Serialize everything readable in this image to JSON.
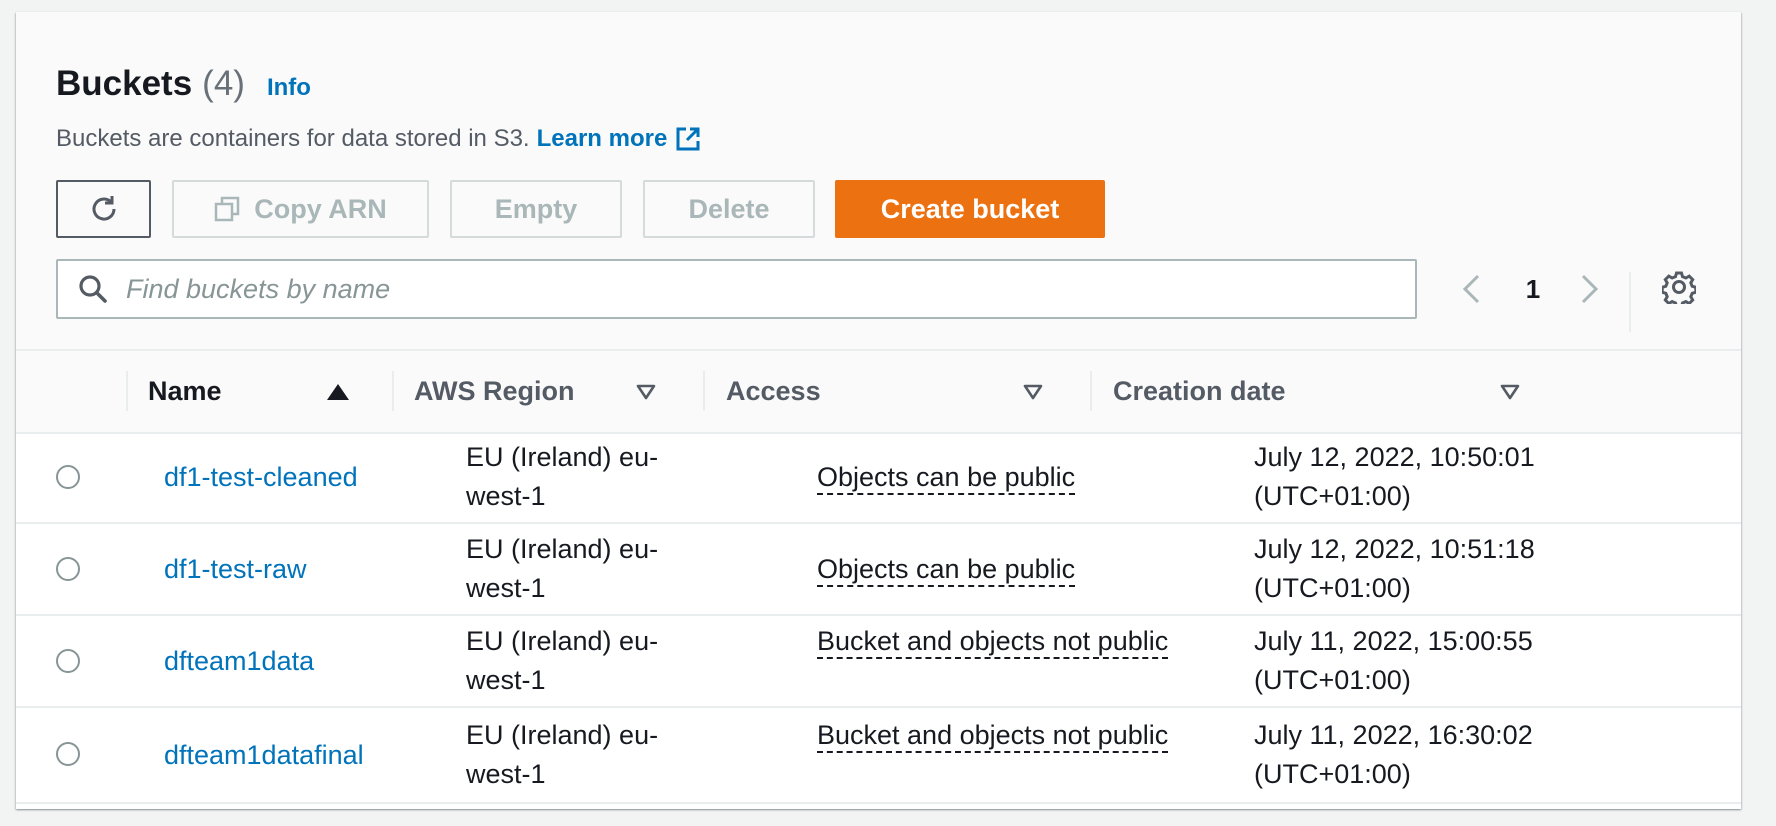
{
  "header": {
    "title": "Buckets",
    "count": "(4)",
    "info_link": "Info",
    "description": "Buckets are containers for data stored in S3.",
    "learn_more": "Learn more"
  },
  "toolbar": {
    "refresh_icon": "refresh-icon",
    "copy_arn_label": "Copy ARN",
    "empty_label": "Empty",
    "delete_label": "Delete",
    "create_label": "Create bucket",
    "disabled_color": "#aab7b8",
    "primary_color": "#ec7211"
  },
  "search": {
    "placeholder": "Find buckets by name",
    "value": ""
  },
  "pagination": {
    "current_page": "1"
  },
  "table": {
    "columns": [
      {
        "label": "Name",
        "sort": "ascending"
      },
      {
        "label": "AWS Region",
        "sort": "none"
      },
      {
        "label": "Access",
        "sort": "none"
      },
      {
        "label": "Creation date",
        "sort": "none"
      }
    ],
    "rows": [
      {
        "name": "df1-test-cleaned",
        "region": "EU (Ireland) eu-west-1",
        "access": "Objects can be public",
        "date": "July 12, 2022, 10:50:01 (UTC+01:00)"
      },
      {
        "name": "df1-test-raw",
        "region": "EU (Ireland) eu-west-1",
        "access": "Objects can be public",
        "date": "July 12, 2022, 10:51:18 (UTC+01:00)"
      },
      {
        "name": "dfteam1data",
        "region": "EU (Ireland) eu-west-1",
        "access": "Bucket and objects not public",
        "date": "July 11, 2022, 15:00:55 (UTC+01:00)"
      },
      {
        "name": "dfteam1datafinal",
        "region": "EU (Ireland) eu-west-1",
        "access": "Bucket and objects not public",
        "date": "July 11, 2022, 16:30:02 (UTC+01:00)"
      }
    ]
  },
  "colors": {
    "link": "#0073bb",
    "text": "#16191f",
    "secondary_text": "#545b64"
  }
}
